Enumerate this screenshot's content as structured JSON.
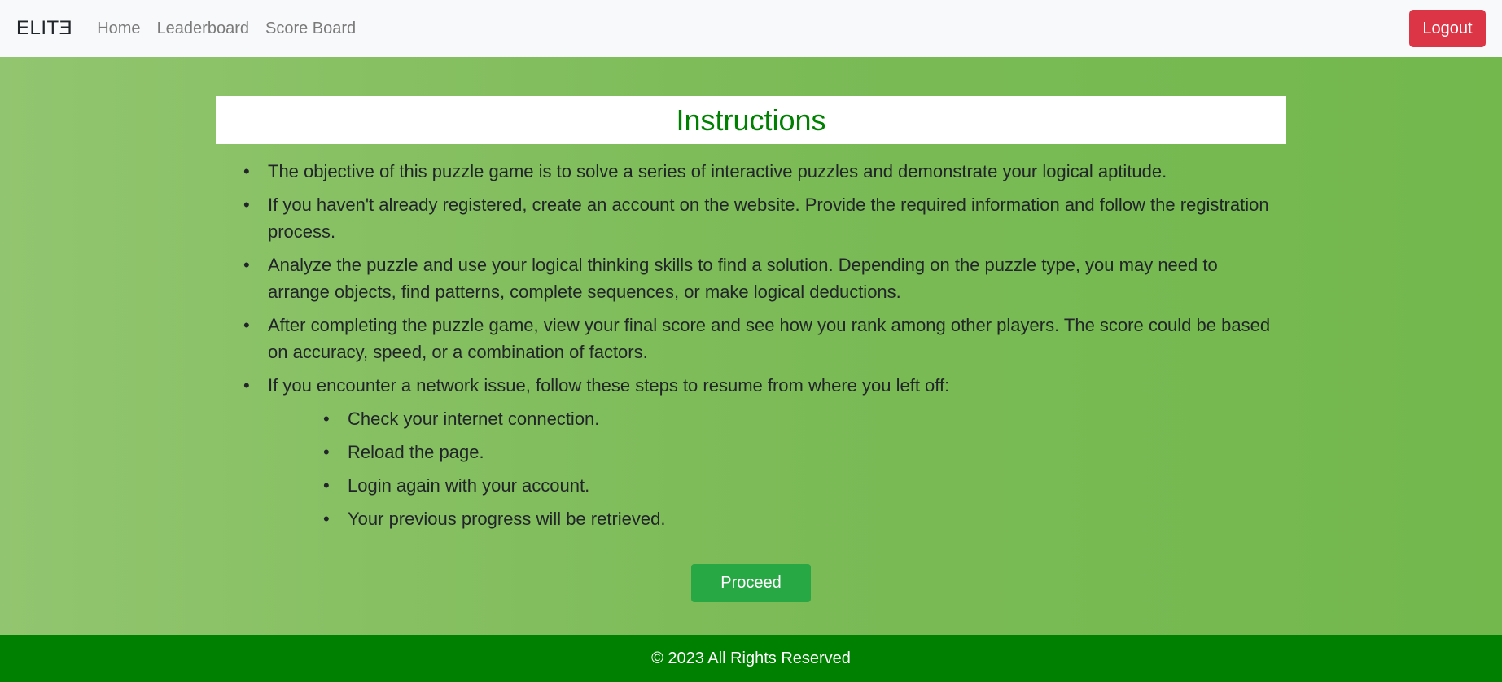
{
  "navbar": {
    "brand": "ELITƎ",
    "links": [
      "Home",
      "Leaderboard",
      "Score Board"
    ],
    "logout_label": "Logout"
  },
  "main": {
    "title": "Instructions",
    "items": [
      "The objective of this puzzle game is to solve a series of interactive puzzles and demonstrate your logical aptitude.",
      "If you haven't already registered, create an account on the website. Provide the required information and follow the registration process.",
      "Analyze the puzzle and use your logical thinking skills to find a solution. Depending on the puzzle type, you may need to arrange objects, find patterns, complete sequences, or make logical deductions.",
      "After completing the puzzle game, view your final score and see how you rank among other players. The score could be based on accuracy, speed, or a combination of factors.",
      "If you encounter a network issue, follow these steps to resume from where you left off:"
    ],
    "sub_items": [
      "Check your internet connection.",
      "Reload the page.",
      "Login again with your account.",
      "Your previous progress will be retrieved."
    ],
    "proceed_label": "Proceed"
  },
  "footer": {
    "text": "© 2023 All Rights Reserved"
  },
  "colors": {
    "navbar_bg": "#f8f9fa",
    "logout_bg": "#dc3545",
    "title_color": "#008000",
    "proceed_bg": "#28a745",
    "footer_bg": "#008000"
  }
}
